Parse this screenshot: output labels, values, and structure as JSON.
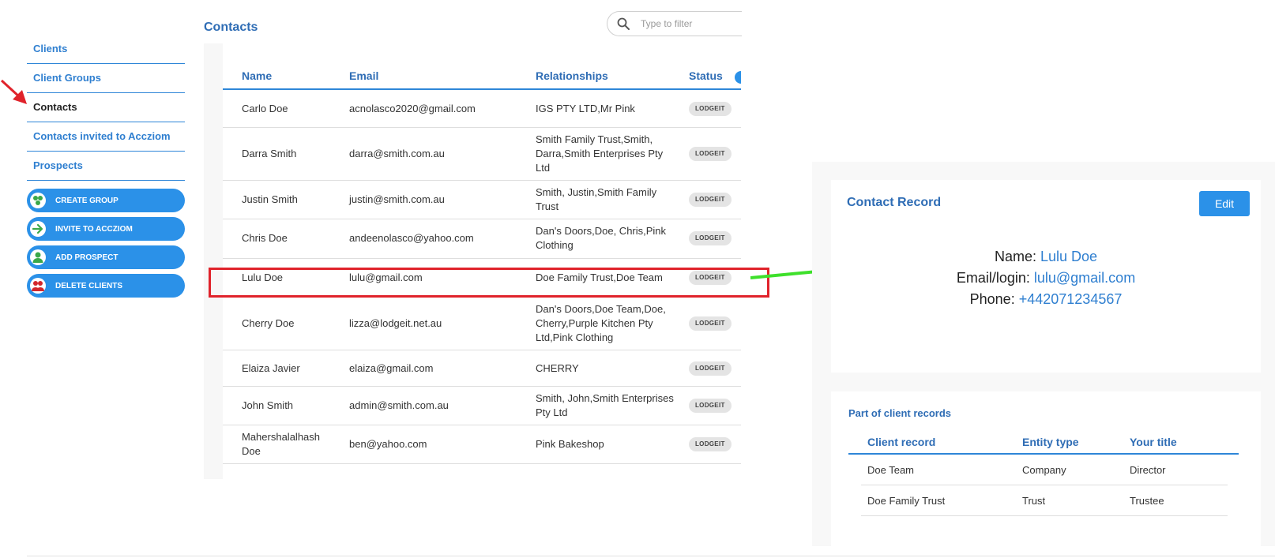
{
  "sidebar": {
    "nav": [
      {
        "label": "Clients",
        "active": false
      },
      {
        "label": "Client Groups",
        "active": false
      },
      {
        "label": "Contacts",
        "active": true
      },
      {
        "label": "Contacts invited to Accziom",
        "active": false
      },
      {
        "label": "Prospects",
        "active": false
      }
    ],
    "actions": [
      {
        "label": "CREATE GROUP",
        "icon": "group-icon"
      },
      {
        "label": "INVITE TO ACCZIOM",
        "icon": "arrow-right-icon"
      },
      {
        "label": "ADD PROSPECT",
        "icon": "person-icon"
      },
      {
        "label": "DELETE CLIENTS",
        "icon": "delete-people-icon"
      }
    ]
  },
  "contacts": {
    "title": "Contacts",
    "search_placeholder": "Type to filter",
    "columns": [
      "Name",
      "Email",
      "Relationships",
      "Status"
    ],
    "rows": [
      {
        "name": "Carlo Doe",
        "email": "acnolasco2020@gmail.com",
        "relationships": "IGS PTY LTD,Mr Pink",
        "status": "LODGEIT"
      },
      {
        "name": "Darra Smith",
        "email": "darra@smith.com.au",
        "relationships": "Smith Family Trust,Smith, Darra,Smith Enterprises Pty Ltd",
        "status": "LODGEIT"
      },
      {
        "name": "Justin Smith",
        "email": "justin@smith.com.au",
        "relationships": "Smith, Justin,Smith Family Trust",
        "status": "LODGEIT"
      },
      {
        "name": "Chris Doe",
        "email": "andeenolasco@yahoo.com",
        "relationships": "Dan's Doors,Doe, Chris,Pink Clothing",
        "status": "LODGEIT"
      },
      {
        "name": "Lulu Doe",
        "email": "lulu@gmail.com",
        "relationships": "Doe Family Trust,Doe Team",
        "status": "LODGEIT"
      },
      {
        "name": "Cherry Doe",
        "email": "lizza@lodgeit.net.au",
        "relationships": "Dan's Doors,Doe Team,Doe, Cherry,Purple Kitchen Pty Ltd,Pink Clothing",
        "status": "LODGEIT"
      },
      {
        "name": "Elaiza Javier",
        "email": "elaiza@gmail.com",
        "relationships": "CHERRY",
        "status": "LODGEIT"
      },
      {
        "name": "John Smith",
        "email": "admin@smith.com.au",
        "relationships": "Smith, John,Smith Enterprises Pty Ltd",
        "status": "LODGEIT"
      },
      {
        "name": "Mahershalalhash Doe",
        "email": "ben@yahoo.com",
        "relationships": "Pink Bakeshop",
        "status": "LODGEIT"
      }
    ]
  },
  "record": {
    "title": "Contact Record",
    "edit_label": "Edit",
    "name_label": "Name:",
    "name_value": "Lulu Doe",
    "email_label": "Email/login:",
    "email_value": "lulu@gmail.com",
    "phone_label": "Phone:",
    "phone_value": "+442071234567"
  },
  "parts": {
    "title": "Part of client records",
    "columns": [
      "Client record",
      "Entity type",
      "Your title"
    ],
    "rows": [
      {
        "record": "Doe Team",
        "entity": "Company",
        "title": "Director"
      },
      {
        "record": "Doe Family Trust",
        "entity": "Trust",
        "title": "Trustee"
      }
    ]
  },
  "colors": {
    "accent": "#2b91e8",
    "title": "#2f6db5",
    "highlight": "#e0232b",
    "arrow_green": "#3ee02b"
  }
}
